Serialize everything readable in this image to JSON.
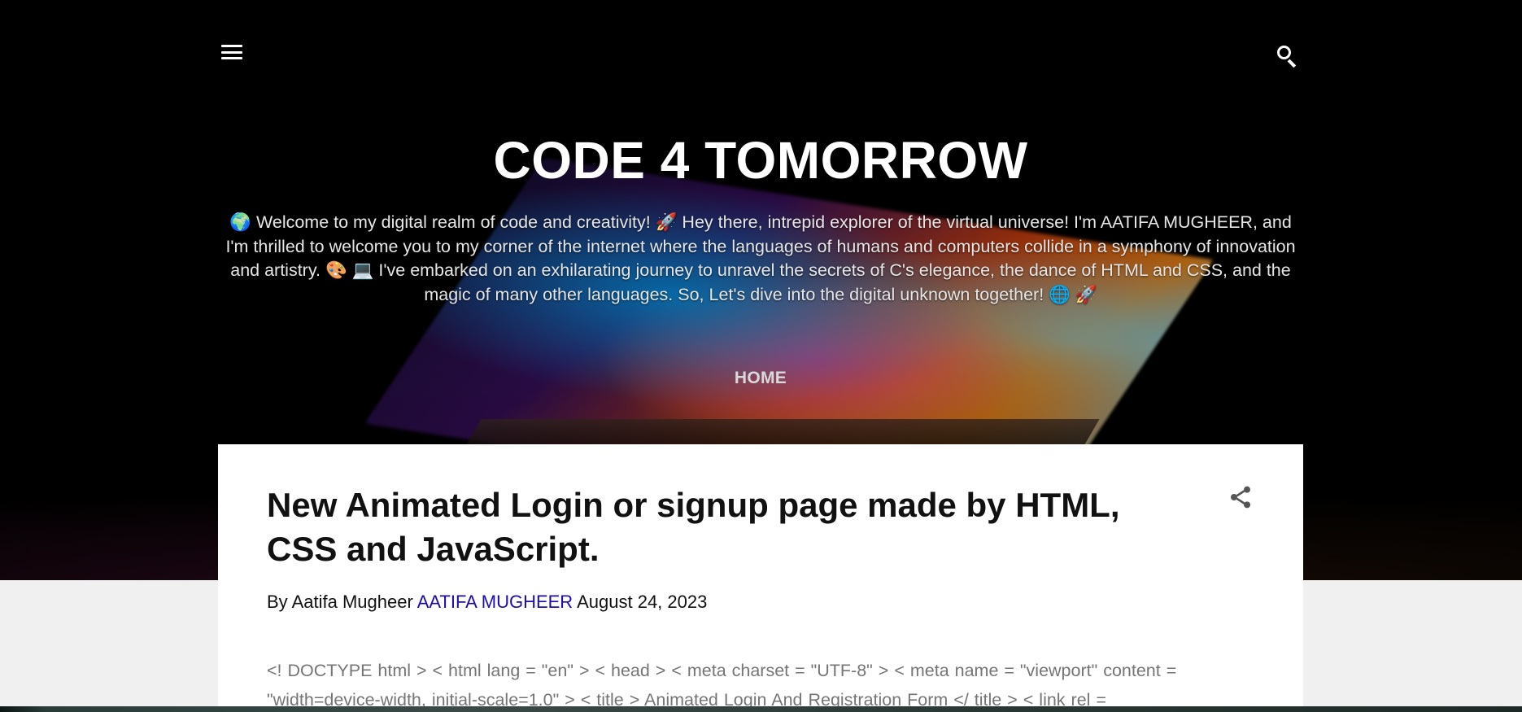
{
  "header": {
    "menu_icon": "hamburger-menu-icon",
    "search_icon": "search-icon",
    "site_title": "CODE 4 TOMORROW",
    "description": "🌍 Welcome to my digital realm of code and creativity! 🚀 Hey there, intrepid explorer of the virtual universe! I'm AATIFA MUGHEER, and I'm thrilled to welcome you to my corner of the internet where the languages of humans and computers collide in a symphony of innovation and artistry. 🎨 💻 I've embarked on an exhilarating journey to unravel the secrets of C's elegance, the dance of HTML and CSS, and the magic of many other languages. So, Let's dive into the digital unknown together! 🌐 🚀",
    "nav": {
      "home_label": "HOME"
    }
  },
  "post": {
    "title": "New Animated Login or signup page made by HTML, CSS and JavaScript.",
    "share_icon": "share-icon",
    "byline_prefix": "By Aatifa Mugheer",
    "author_link": "AATIFA MUGHEER",
    "date": "August 24, 2023",
    "snippet": " <! DOCTYPE html > < html lang = \"en\" > < head >     < meta charset = \"UTF-8\" >     < meta name = \"viewport\" content = \"width=device-width, initial-scale=1.0\" >     < title > Animated Login And Registration Form </ title >     < link rel ="
  },
  "colors": {
    "hero_background": "#000000",
    "page_background": "#f0f0f0",
    "card_background": "#ffffff",
    "link": "#1a0dab",
    "snippet_text": "#757575"
  }
}
